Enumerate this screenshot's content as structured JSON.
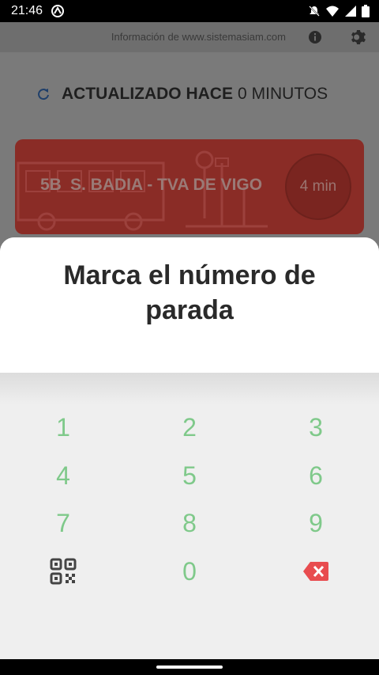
{
  "status_bar": {
    "time": "21:46"
  },
  "top_bar": {
    "info_text": "Información de www.sistemasiam.com"
  },
  "updated": {
    "label": "ACTUALIZADO HACE",
    "value": "0",
    "units": "MINUTOS"
  },
  "bus": {
    "line": "5B",
    "route": "S. BADIA - TVA DE VIGO",
    "eta": "4 min"
  },
  "dialog": {
    "title": "Marca el número de parada",
    "keys": [
      "1",
      "2",
      "3",
      "4",
      "5",
      "6",
      "7",
      "8",
      "9",
      "0"
    ]
  },
  "colors": {
    "accent_green": "#7fc98a",
    "delete_red": "#e84c4f",
    "card_red": "#8a2c26"
  },
  "icons": {
    "qr": "qr-code-icon",
    "delete": "backspace-icon",
    "refresh": "refresh-icon",
    "info": "info-icon",
    "settings": "gear-icon"
  }
}
